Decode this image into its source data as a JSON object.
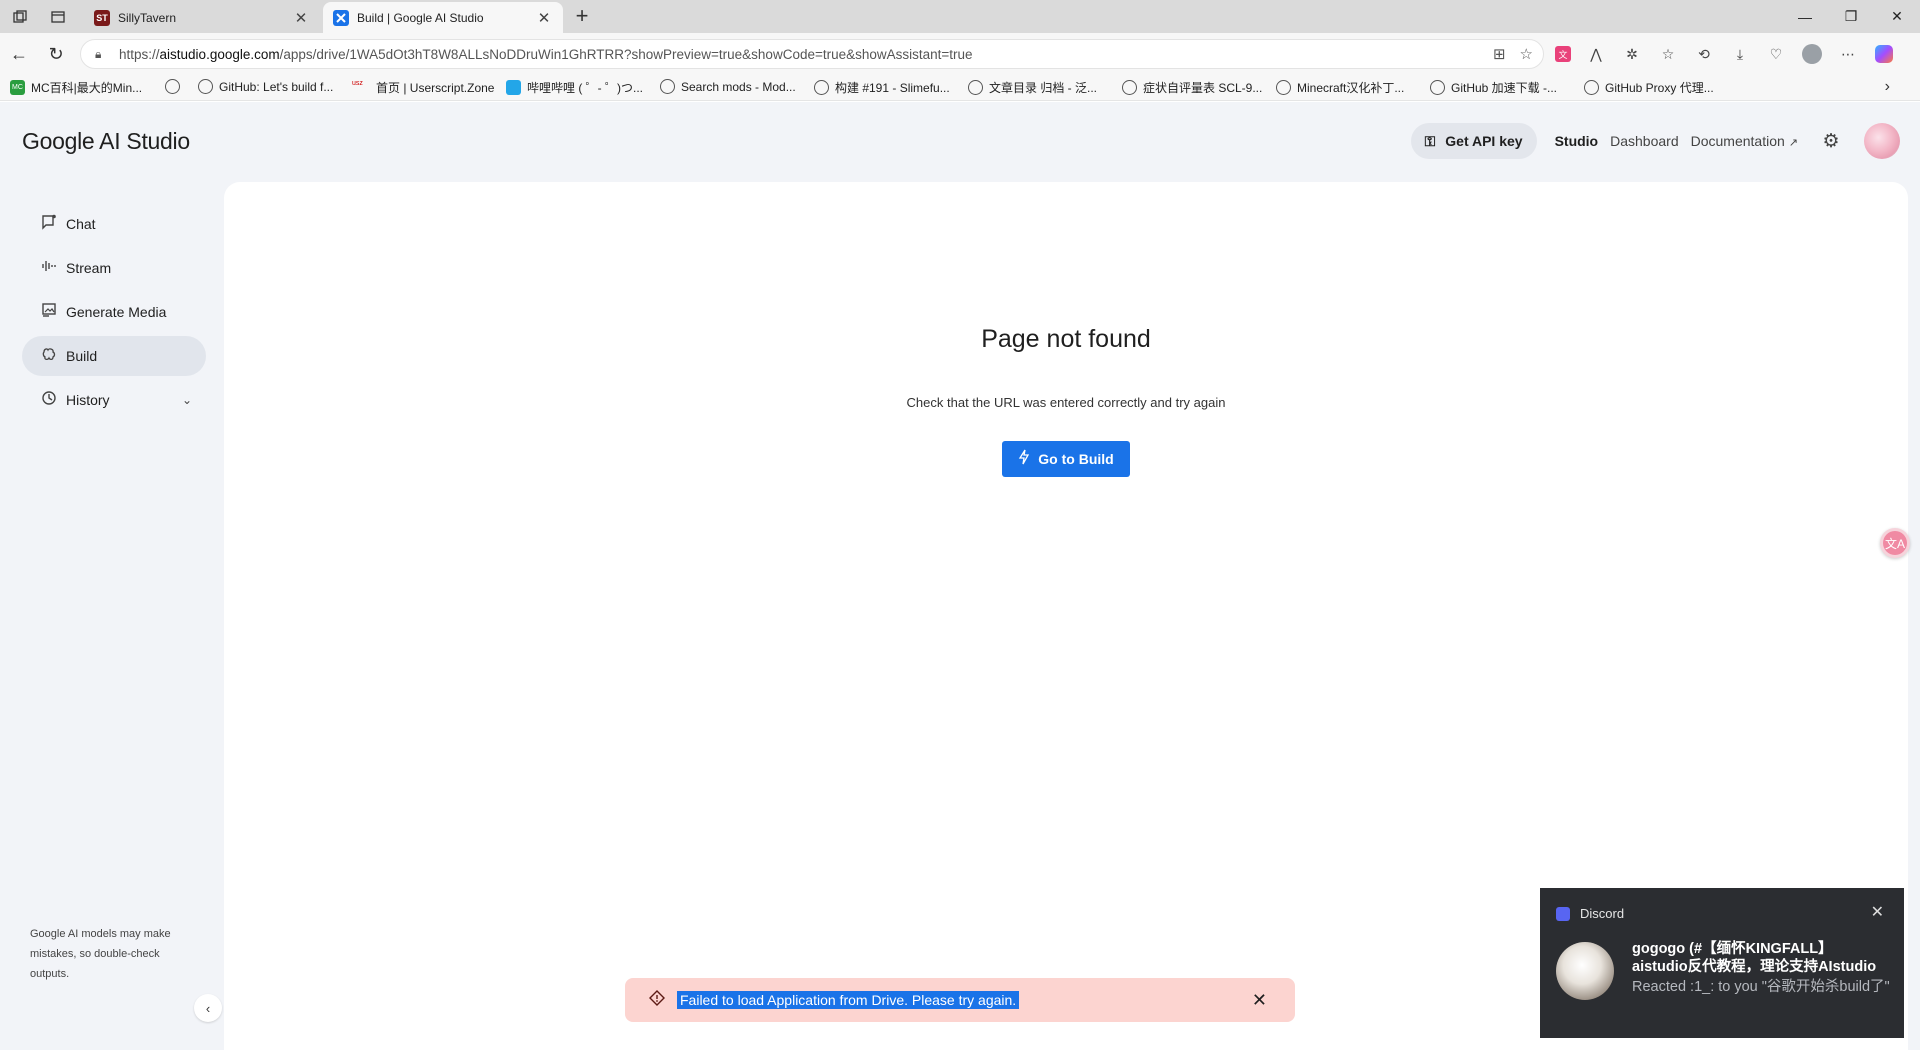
{
  "browser": {
    "tabs": [
      {
        "title": "SillyTavern",
        "active": false,
        "favicon": "ST"
      },
      {
        "title": "Build | Google AI Studio",
        "active": true,
        "favicon": ""
      }
    ],
    "url": {
      "scheme": "https://",
      "host": "aistudio.google.com",
      "path": "/apps/drive/1WA5dOt3hT8W8ALLsNoDDruWin1GhRTRR?showPreview=true&showCode=true&showAssistant=true"
    },
    "bookmarks": [
      "MC百科|最大的Min...",
      "GitHub: Let's build f...",
      "首页 | Userscript.Zone",
      "哔哩哔哩 ( ゜- ゜)つ...",
      "Search mods - Mod...",
      "构建 #191 - Slimefu...",
      "文章目录 归档 - 泛...",
      "症状自评量表 SCL-9...",
      "Minecraft汉化补丁...",
      "GitHub 加速下载 -...",
      "GitHub Proxy 代理..."
    ],
    "bookmark_icon_label_usz": "usz",
    "bookmark_icon_label_mc": "MC"
  },
  "app": {
    "logo": "Google AI Studio",
    "header": {
      "api_key_label": "Get API key",
      "links": [
        "Studio",
        "Dashboard",
        "Documentation"
      ]
    },
    "nav": [
      {
        "label": "Chat",
        "icon": "chat-icon"
      },
      {
        "label": "Stream",
        "icon": "waveform-icon"
      },
      {
        "label": "Generate Media",
        "icon": "image-icon"
      },
      {
        "label": "Build",
        "icon": "build-icon",
        "selected": true
      },
      {
        "label": "History",
        "icon": "history-icon",
        "expandable": true
      }
    ],
    "disclaimer": "Google AI models may make mistakes, so double-check outputs.",
    "main": {
      "title": "Page not found",
      "subtitle": "Check that the URL was entered correctly and try again",
      "button_label": "Go to Build"
    },
    "snackbar": {
      "message": "Failed to load Application from Drive. Please try again."
    },
    "translate_fab": "文A"
  },
  "notification": {
    "app_name": "Discord",
    "title_line1": "gogogo (#【缅怀KINGFALL】",
    "title_line2": "aistudio反代教程，理论支持AIstudio",
    "body": "Reacted :1_: to you \"谷歌开始杀build了\""
  },
  "colors": {
    "accent": "#1a73e8",
    "snackbar_bg": "#fcd4d0",
    "app_bg": "#f2f4f8",
    "discord_bg": "#2b2d31"
  }
}
